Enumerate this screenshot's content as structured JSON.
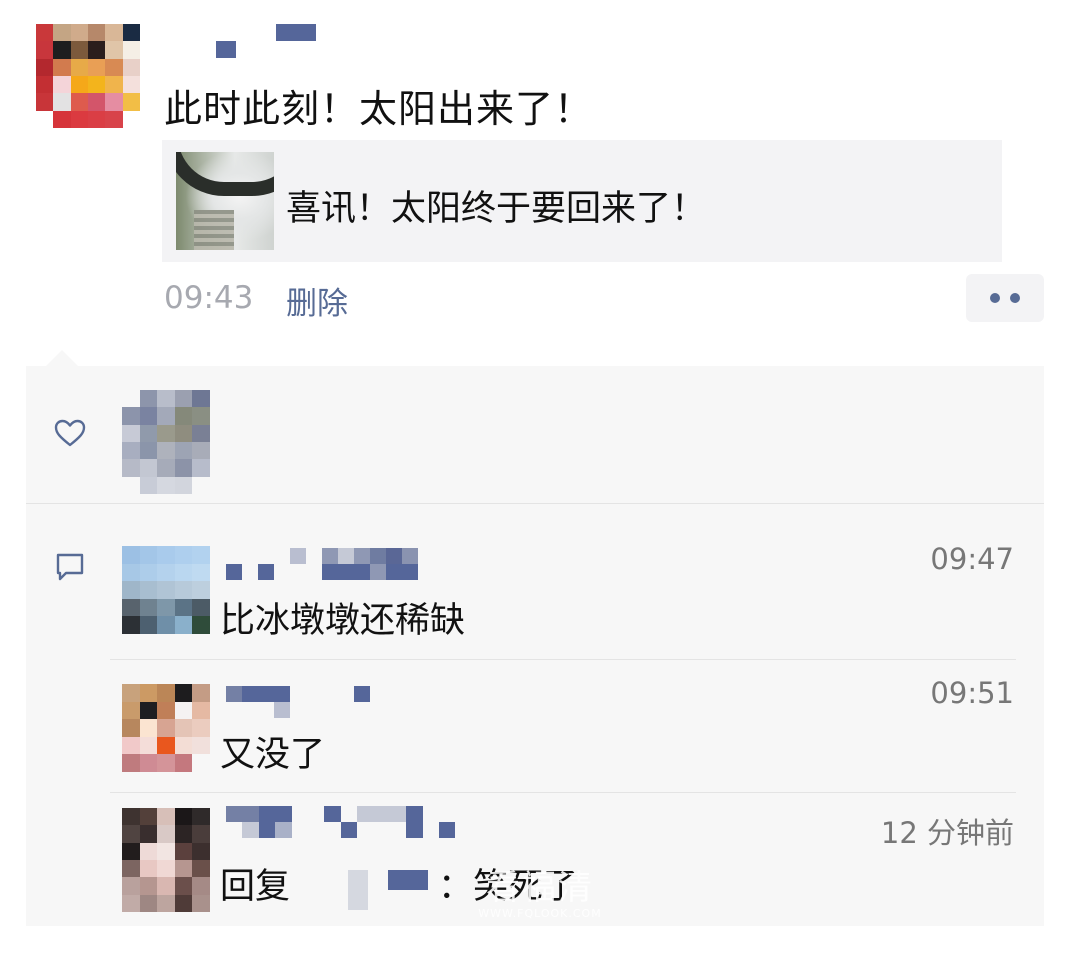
{
  "post": {
    "text": "此时此刻！太阳出来了！",
    "link_card": {
      "title": "喜讯！太阳终于要回来了！"
    },
    "time": "09:43",
    "delete_label": "删除"
  },
  "likes": {
    "icon": "heart-icon"
  },
  "comments": [
    {
      "text": "比冰墩墩还稀缺",
      "time": "09:47"
    },
    {
      "text": "又没了",
      "time": "09:51"
    },
    {
      "reply_prefix": "回复",
      "text": "：笑死了",
      "time": "12 分钟前"
    }
  ],
  "colors": {
    "link_blue": "#576b95",
    "panel_bg": "#f7f7f7",
    "time_gray": "#a7a9b0"
  },
  "watermark": {
    "main": "看福清",
    "url": "WWW.FQLOOK.COM"
  }
}
